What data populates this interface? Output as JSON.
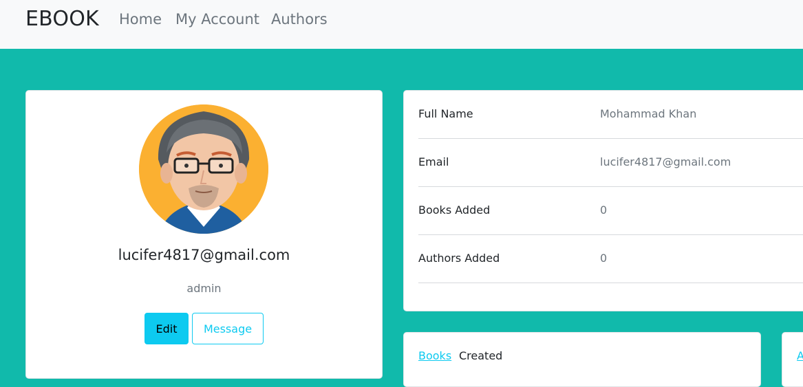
{
  "navbar": {
    "brand": "EBOOK",
    "links": [
      "Home",
      "My Account",
      "Authors"
    ]
  },
  "profile": {
    "email": "lucifer4817@gmail.com",
    "role": "admin",
    "edit_label": "Edit",
    "message_label": "Message",
    "avatar_icon": "avatar-man-glasses"
  },
  "details": [
    {
      "label": "Full Name",
      "value": "Mohammad Khan"
    },
    {
      "label": "Email",
      "value": "lucifer4817@gmail.com"
    },
    {
      "label": "Books Added",
      "value": "0"
    },
    {
      "label": "Authors Added",
      "value": "0"
    }
  ],
  "bottom_tabs": {
    "books_link": "Books",
    "created_label": "Created",
    "second_card_link": "A"
  },
  "colors": {
    "background": "#11baab",
    "navbar": "#f8f9fa",
    "accent": "#0dcaf0",
    "avatar_bg": "#fbb031"
  }
}
